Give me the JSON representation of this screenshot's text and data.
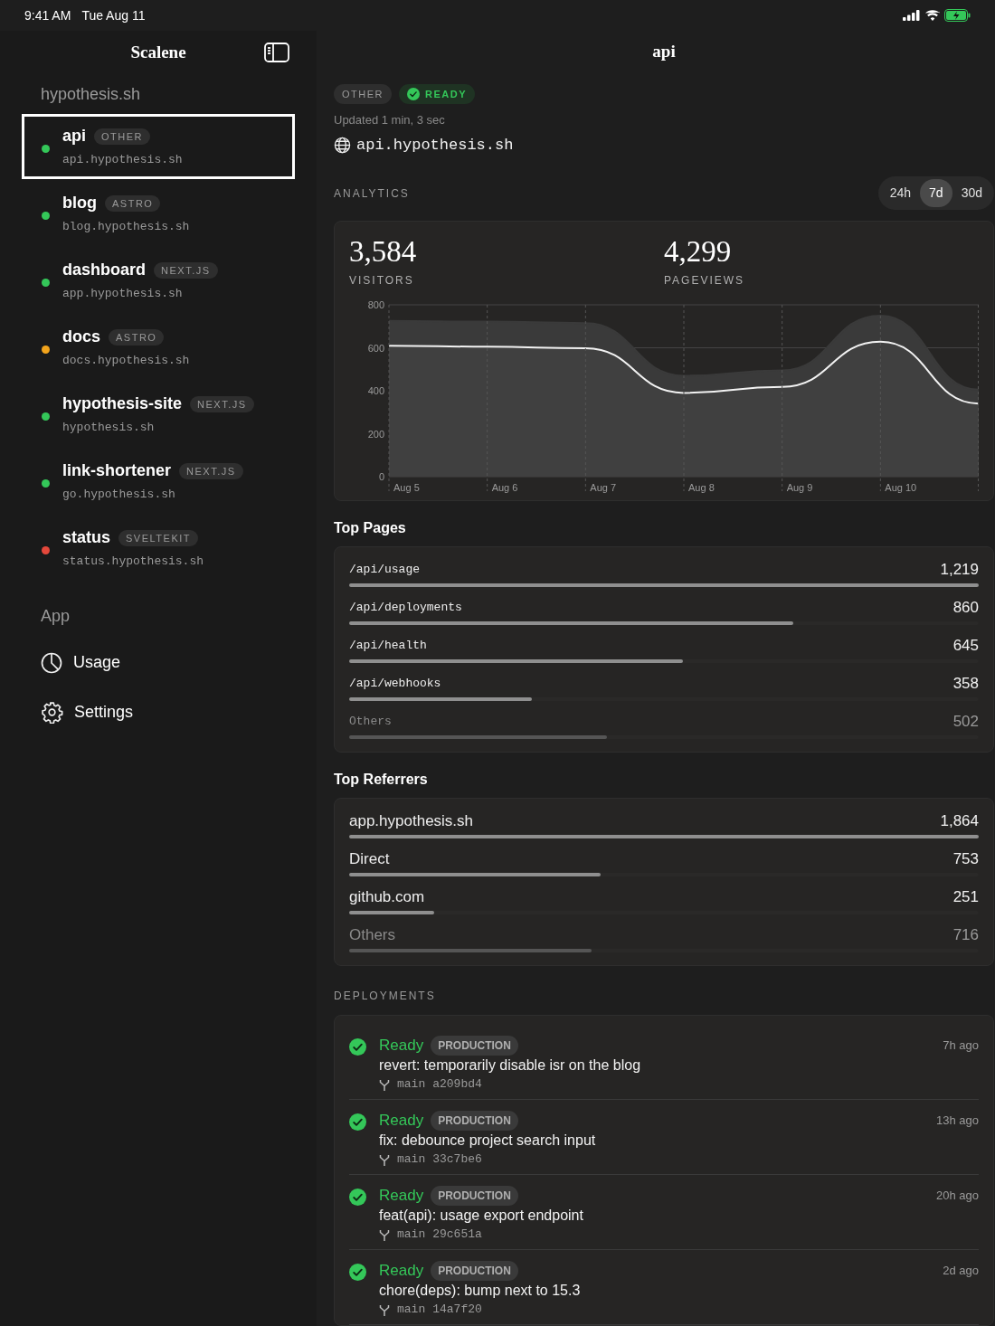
{
  "status_bar": {
    "time": "9:41 AM",
    "date": "Tue Aug 11"
  },
  "sidebar": {
    "title": "Scalene",
    "group_title": "hypothesis.sh",
    "projects": [
      {
        "name": "api",
        "framework": "OTHER",
        "domain": "api.hypothesis.sh",
        "color": "#34c759",
        "selected": true
      },
      {
        "name": "blog",
        "framework": "ASTRO",
        "domain": "blog.hypothesis.sh",
        "color": "#34c759",
        "selected": false
      },
      {
        "name": "dashboard",
        "framework": "NEXT.JS",
        "domain": "app.hypothesis.sh",
        "color": "#34c759",
        "selected": false
      },
      {
        "name": "docs",
        "framework": "ASTRO",
        "domain": "docs.hypothesis.sh",
        "color": "#f2a41c",
        "selected": false
      },
      {
        "name": "hypothesis-site",
        "framework": "NEXT.JS",
        "domain": "hypothesis.sh",
        "color": "#34c759",
        "selected": false
      },
      {
        "name": "link-shortener",
        "framework": "NEXT.JS",
        "domain": "go.hypothesis.sh",
        "color": "#34c759",
        "selected": false
      },
      {
        "name": "status",
        "framework": "SVELTEKIT",
        "domain": "status.hypothesis.sh",
        "color": "#e5483b",
        "selected": false
      }
    ],
    "app_title": "App",
    "app_items": [
      {
        "label": "Usage",
        "kind": "usage"
      },
      {
        "label": "Settings",
        "kind": "settings"
      }
    ]
  },
  "main": {
    "title": "api",
    "framework": "OTHER",
    "status": "READY",
    "updated": "Updated 1 min, 3 sec",
    "domain": "api.hypothesis.sh",
    "analytics_title": "ANALYTICS",
    "ranges": [
      {
        "label": "24h",
        "selected": false
      },
      {
        "label": "7d",
        "selected": true
      },
      {
        "label": "30d",
        "selected": false
      }
    ],
    "stats": [
      {
        "value": "3,584",
        "label": "VISITORS"
      },
      {
        "value": "4,299",
        "label": "PAGEVIEWS"
      }
    ],
    "chart_data": {
      "type": "area",
      "categories": [
        "Aug 5",
        "Aug 6",
        "Aug 7",
        "Aug 8",
        "Aug 9",
        "Aug 10",
        null
      ],
      "ylim": [
        0,
        800
      ],
      "yticks": [
        0,
        200,
        400,
        600,
        800
      ],
      "series": [
        {
          "color": "#3a3a3a",
          "values": [
            725,
            722,
            715,
            470,
            495,
            750,
            405
          ]
        },
        {
          "color": "#f2f2f2",
          "values": [
            610,
            605,
            598,
            390,
            418,
            628,
            340
          ]
        }
      ]
    },
    "top_pages": {
      "title": "Top Pages",
      "rows": [
        {
          "label": "/api/usage",
          "value": "1,219",
          "level": 1.0,
          "muted": false
        },
        {
          "label": "/api/deployments",
          "value": "860",
          "level": 0.705,
          "muted": false
        },
        {
          "label": "/api/health",
          "value": "645",
          "level": 0.53,
          "muted": false
        },
        {
          "label": "/api/webhooks",
          "value": "358",
          "level": 0.29,
          "muted": false
        },
        {
          "label": "Others",
          "value": "502",
          "level": 0.41,
          "muted": true
        }
      ]
    },
    "top_referrers": {
      "title": "Top Referrers",
      "rows": [
        {
          "label": "app.hypothesis.sh",
          "value": "1,864",
          "level": 1.0,
          "muted": false
        },
        {
          "label": "Direct",
          "value": "753",
          "level": 0.4,
          "muted": false
        },
        {
          "label": "github.com",
          "value": "251",
          "level": 0.135,
          "muted": false
        },
        {
          "label": "Others",
          "value": "716",
          "level": 0.385,
          "muted": true
        }
      ]
    },
    "deployments_title": "DEPLOYMENTS",
    "deployments": [
      {
        "status": "Ready",
        "environment": "PRODUCTION",
        "message": "revert: temporarily disable isr on the blog",
        "branch": "main",
        "commit": "a209bd4",
        "time": "7h ago"
      },
      {
        "status": "Ready",
        "environment": "PRODUCTION",
        "message": "fix: debounce project search input",
        "branch": "main",
        "commit": "33c7be6",
        "time": "13h ago"
      },
      {
        "status": "Ready",
        "environment": "PRODUCTION",
        "message": "feat(api): usage export endpoint",
        "branch": "main",
        "commit": "29c651a",
        "time": "20h ago"
      },
      {
        "status": "Ready",
        "environment": "PRODUCTION",
        "message": "chore(deps): bump next to 15.3",
        "branch": "main",
        "commit": "14a7f20",
        "time": "2d ago"
      }
    ]
  }
}
